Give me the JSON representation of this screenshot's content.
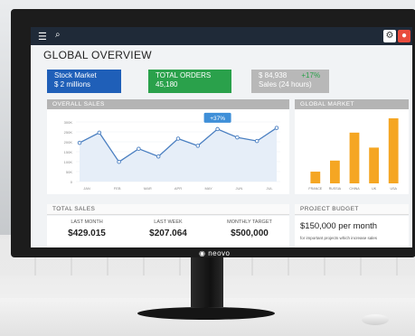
{
  "dashboard": {
    "title": "GLOBAL OVERVIEW",
    "cards": [
      {
        "label": "Stock Market",
        "value": "$ 2 millions",
        "color": "#1f5fb8"
      },
      {
        "label": "TOTAL ORDERS",
        "value": "45,180",
        "color": "#2aa14b"
      },
      {
        "label": "$ 84,938",
        "change": "+17%",
        "sub": "Sales (24 hours)",
        "color": "#b8b8b8"
      }
    ],
    "overall_sales": {
      "header": "OVERALL SALES",
      "callout": "+37%",
      "months": [
        "JAN",
        "FEB",
        "MAR",
        "APR",
        "MAY",
        "JUN",
        "JUL"
      ],
      "yticks": [
        "300K",
        "250K",
        "200K",
        "150K",
        "100K",
        "50K",
        "0"
      ],
      "values": [
        0.65,
        0.82,
        0.33,
        0.55,
        0.42,
        0.72,
        0.6,
        0.88,
        0.74,
        0.68,
        0.9
      ]
    },
    "global_market": {
      "header": "GLOBAL MARKET",
      "categories": [
        "FRANCE",
        "RUSSIA",
        "CHINA",
        "UK",
        "USA"
      ],
      "values": [
        0.18,
        0.35,
        0.78,
        0.55,
        1.0
      ],
      "color": "#f5a623"
    },
    "total_sales": {
      "header": "TOTAL SALES",
      "stats": [
        {
          "label": "LAST MONTH",
          "value": "$429.015"
        },
        {
          "label": "LAST WEEK",
          "value": "$207.064"
        },
        {
          "label": "MONTHLY TARGET",
          "value": "$500,000"
        }
      ]
    },
    "project_budget": {
      "header": "PROJECT BUDGET",
      "amount": "$150,000 per month",
      "note": "for important projects which increase sales"
    }
  },
  "monitor": {
    "brand": "neovo"
  }
}
